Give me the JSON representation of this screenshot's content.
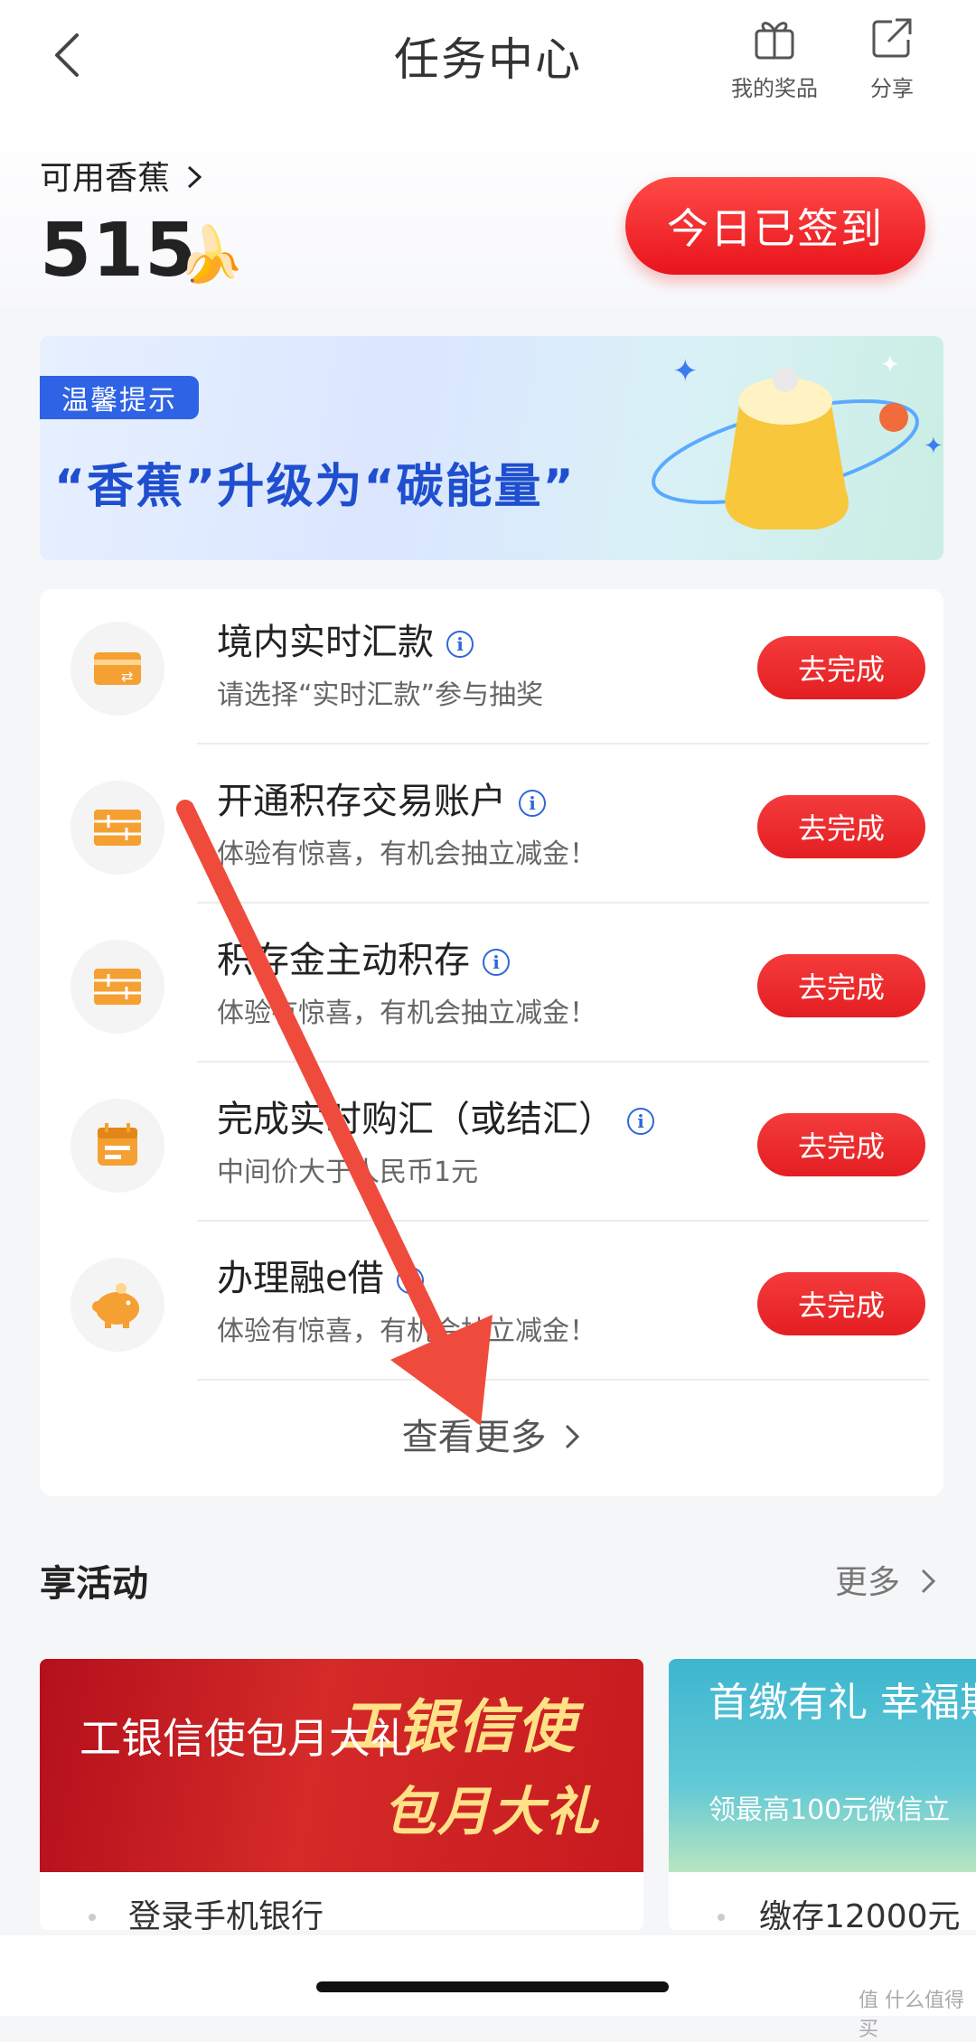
{
  "header": {
    "title": "任务中心",
    "prizes_label": "我的奖品",
    "share_label": "分享"
  },
  "summary": {
    "available_label": "可用香蕉",
    "available_count": "515",
    "banana_glyph": "🍌",
    "sign_label": "今日已签到"
  },
  "banner": {
    "tag": "温馨提示",
    "text": "“香蕉”升级为“碳能量”"
  },
  "tasks": [
    {
      "title": "境内实时汇款",
      "subtitle": "请选择“实时汇款”参与抽奖",
      "button": "去完成",
      "icon": "card-transfer-icon"
    },
    {
      "title": "开通积存交易账户",
      "subtitle": "体验有惊喜，有机会抽立减金！",
      "button": "去完成",
      "icon": "gold-bars-icon"
    },
    {
      "title": "积存金主动积存",
      "subtitle": "体验有惊喜，有机会抽立减金！",
      "button": "去完成",
      "icon": "gold-bars-icon"
    },
    {
      "title": "完成实时购汇（或结汇）",
      "subtitle": "中间价大于人民币1元",
      "button": "去完成",
      "icon": "calendar-icon"
    },
    {
      "title": "办理融e借",
      "subtitle": "体验有惊喜，有机会抽立减金！",
      "button": "去完成",
      "icon": "piggy-bank-icon"
    }
  ],
  "more_link": "查看更多",
  "activities": {
    "title": "享活动",
    "more": "更多",
    "cards": [
      {
        "image_title": "工银信使包月大礼",
        "art_line1": "工银信使",
        "art_line2": "包月大礼",
        "subtitle": "登录手机银行"
      },
      {
        "image_title": "首缴有礼 幸福期）",
        "image_sub": "领最高100元微信立",
        "subtitle": "缴存12000元"
      }
    ]
  },
  "watermark": "值 什么值得买",
  "colors": {
    "accent_red": "#e8141c",
    "brand_blue": "#2e63e6",
    "icon_orange": "#f5a032"
  }
}
